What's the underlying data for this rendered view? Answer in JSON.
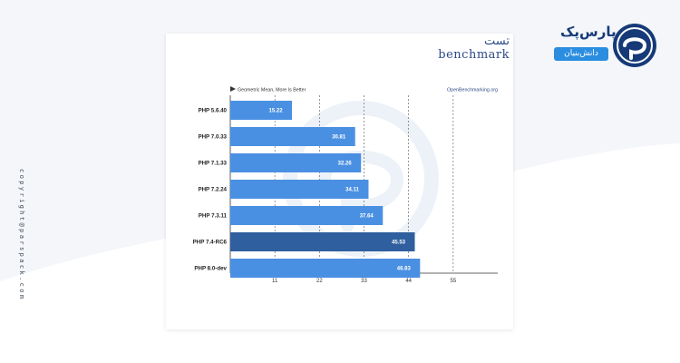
{
  "brand": {
    "name": "پارس‌پک",
    "tagline": "دانش‌بنیان",
    "copyright": "copyright@parspack.com",
    "primary_color": "#2b8de0",
    "dark_color": "#163a78"
  },
  "card": {
    "title": "تست benchmark"
  },
  "chart_data": {
    "type": "bar",
    "orientation": "horizontal",
    "subtitle": "Geometric Mean, More Is Better",
    "source": "OpenBenchmarking.org",
    "categories": [
      "PHP 5.6.40",
      "PHP 7.0.33",
      "PHP 7.1.33",
      "PHP 7.2.24",
      "PHP 7.3.11",
      "PHP 7.4-RC6",
      "PHP 8.0-dev"
    ],
    "values": [
      15.22,
      30.81,
      32.26,
      34.11,
      37.64,
      45.53,
      46.83
    ],
    "value_labels": [
      "15.22",
      "30.81",
      "32.26",
      "34.11",
      "37.64",
      "45.53",
      "46.83"
    ],
    "highlight_index": 5,
    "xticks": [
      11,
      22,
      33,
      44,
      55
    ],
    "xlim": [
      0,
      66
    ],
    "grid": true,
    "bar_color": "#4a90e2",
    "highlight_color": "#2f5f9e"
  }
}
